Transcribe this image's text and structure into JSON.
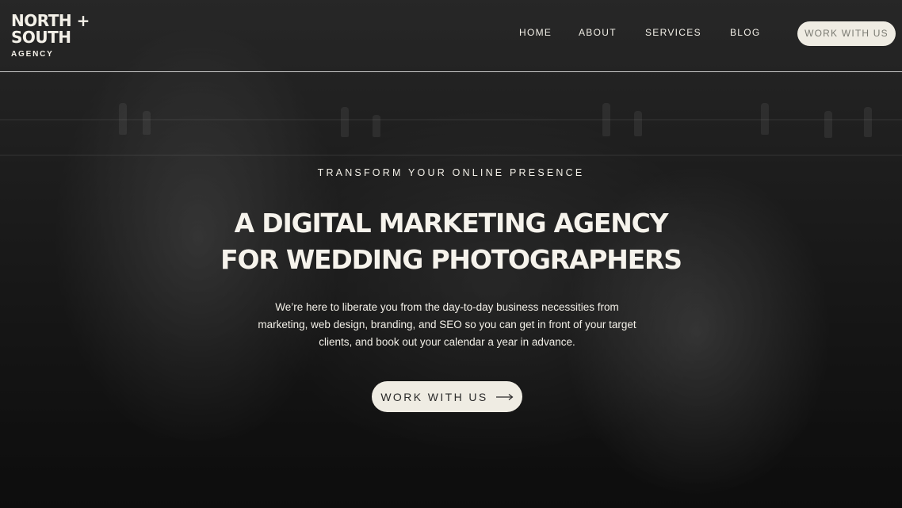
{
  "brand": {
    "logo_line1": "NORTH +",
    "logo_line2": "SOUTH",
    "logo_sub": "AGENCY"
  },
  "nav": {
    "items": [
      {
        "label": "HOME"
      },
      {
        "label": "ABOUT"
      },
      {
        "label": "SERVICES"
      },
      {
        "label": "BLOG"
      }
    ],
    "cta_label": "WORK WITH US"
  },
  "hero": {
    "kicker": "TRANSFORM YOUR ONLINE PRESENCE",
    "headline_line1": "A DIGITAL MARKETING AGENCY",
    "headline_line2": "FOR WEDDING PHOTOGRAPHERS",
    "description": "We’re here to liberate you from the day-to-day business necessities from marketing, web design, branding, and SEO so you can get in front of your target clients, and book out your calendar a year in advance.",
    "cta_label": "WORK WITH US",
    "cta_icon": "arrow-right-icon"
  },
  "colors": {
    "cta_bg": "#efece3",
    "text": "#f3f0e8"
  }
}
